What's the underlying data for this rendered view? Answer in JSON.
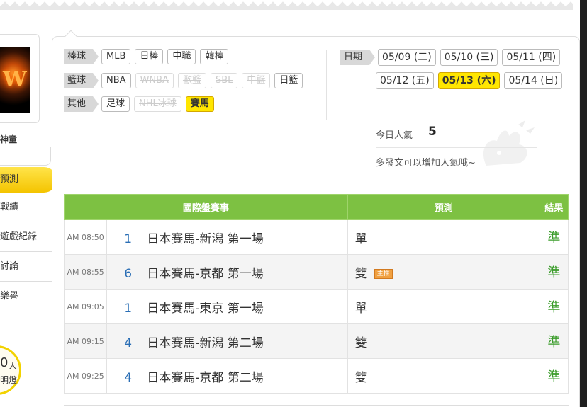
{
  "sidebar": {
    "avatar_letter": "W",
    "username": "神童",
    "menu": [
      "預測",
      "戰績",
      "遊戲紀錄",
      "討論",
      "樂譽"
    ],
    "popularity_num": "0",
    "popularity_unit": "人",
    "popularity_caption": "明燈"
  },
  "filters": {
    "baseball": {
      "label": "棒球",
      "tags": [
        "MLB",
        "日棒",
        "中職",
        "韓棒"
      ]
    },
    "basketball": {
      "label": "籃球",
      "tags": [
        "NBA",
        "WNBA",
        "歐籃",
        "SBL",
        "中籃",
        "日籃"
      ]
    },
    "other": {
      "label": "其他",
      "tags": [
        "足球",
        "NHL冰球",
        "賽馬"
      ]
    }
  },
  "dates": {
    "label": "日期",
    "items": [
      "05/09 (二)",
      "05/10 (三)",
      "05/11 (四)",
      "05/12 (五)",
      "05/13 (六)",
      "05/14 (日)"
    ],
    "selected": "05/13 (六)"
  },
  "popularity": {
    "label": "今日人氣",
    "value": "5",
    "hint": "多發文可以增加人氣哦~"
  },
  "table": {
    "headers": [
      "國際盤賽事",
      "預測",
      "結果"
    ],
    "badge": "主推",
    "rows": [
      {
        "time": "AM 08:50",
        "num": "1",
        "race": "日本賽馬-新潟 第一場",
        "pred": "單",
        "result": "準"
      },
      {
        "time": "AM 08:55",
        "num": "6",
        "race": "日本賽馬-京都 第一場",
        "pred": "雙",
        "result": "準"
      },
      {
        "time": "AM 09:05",
        "num": "1",
        "race": "日本賽馬-東京 第一場",
        "pred": "單",
        "result": "準"
      },
      {
        "time": "AM 09:15",
        "num": "4",
        "race": "日本賽馬-新潟 第二場",
        "pred": "雙",
        "result": "準"
      },
      {
        "time": "AM 09:25",
        "num": "4",
        "race": "日本賽馬-京都 第二場",
        "pred": "雙",
        "result": "準"
      }
    ]
  },
  "colors": {
    "accent_green": "#7dc142",
    "result_green": "#3a9c2a",
    "selected_yellow": "#ffe600"
  }
}
